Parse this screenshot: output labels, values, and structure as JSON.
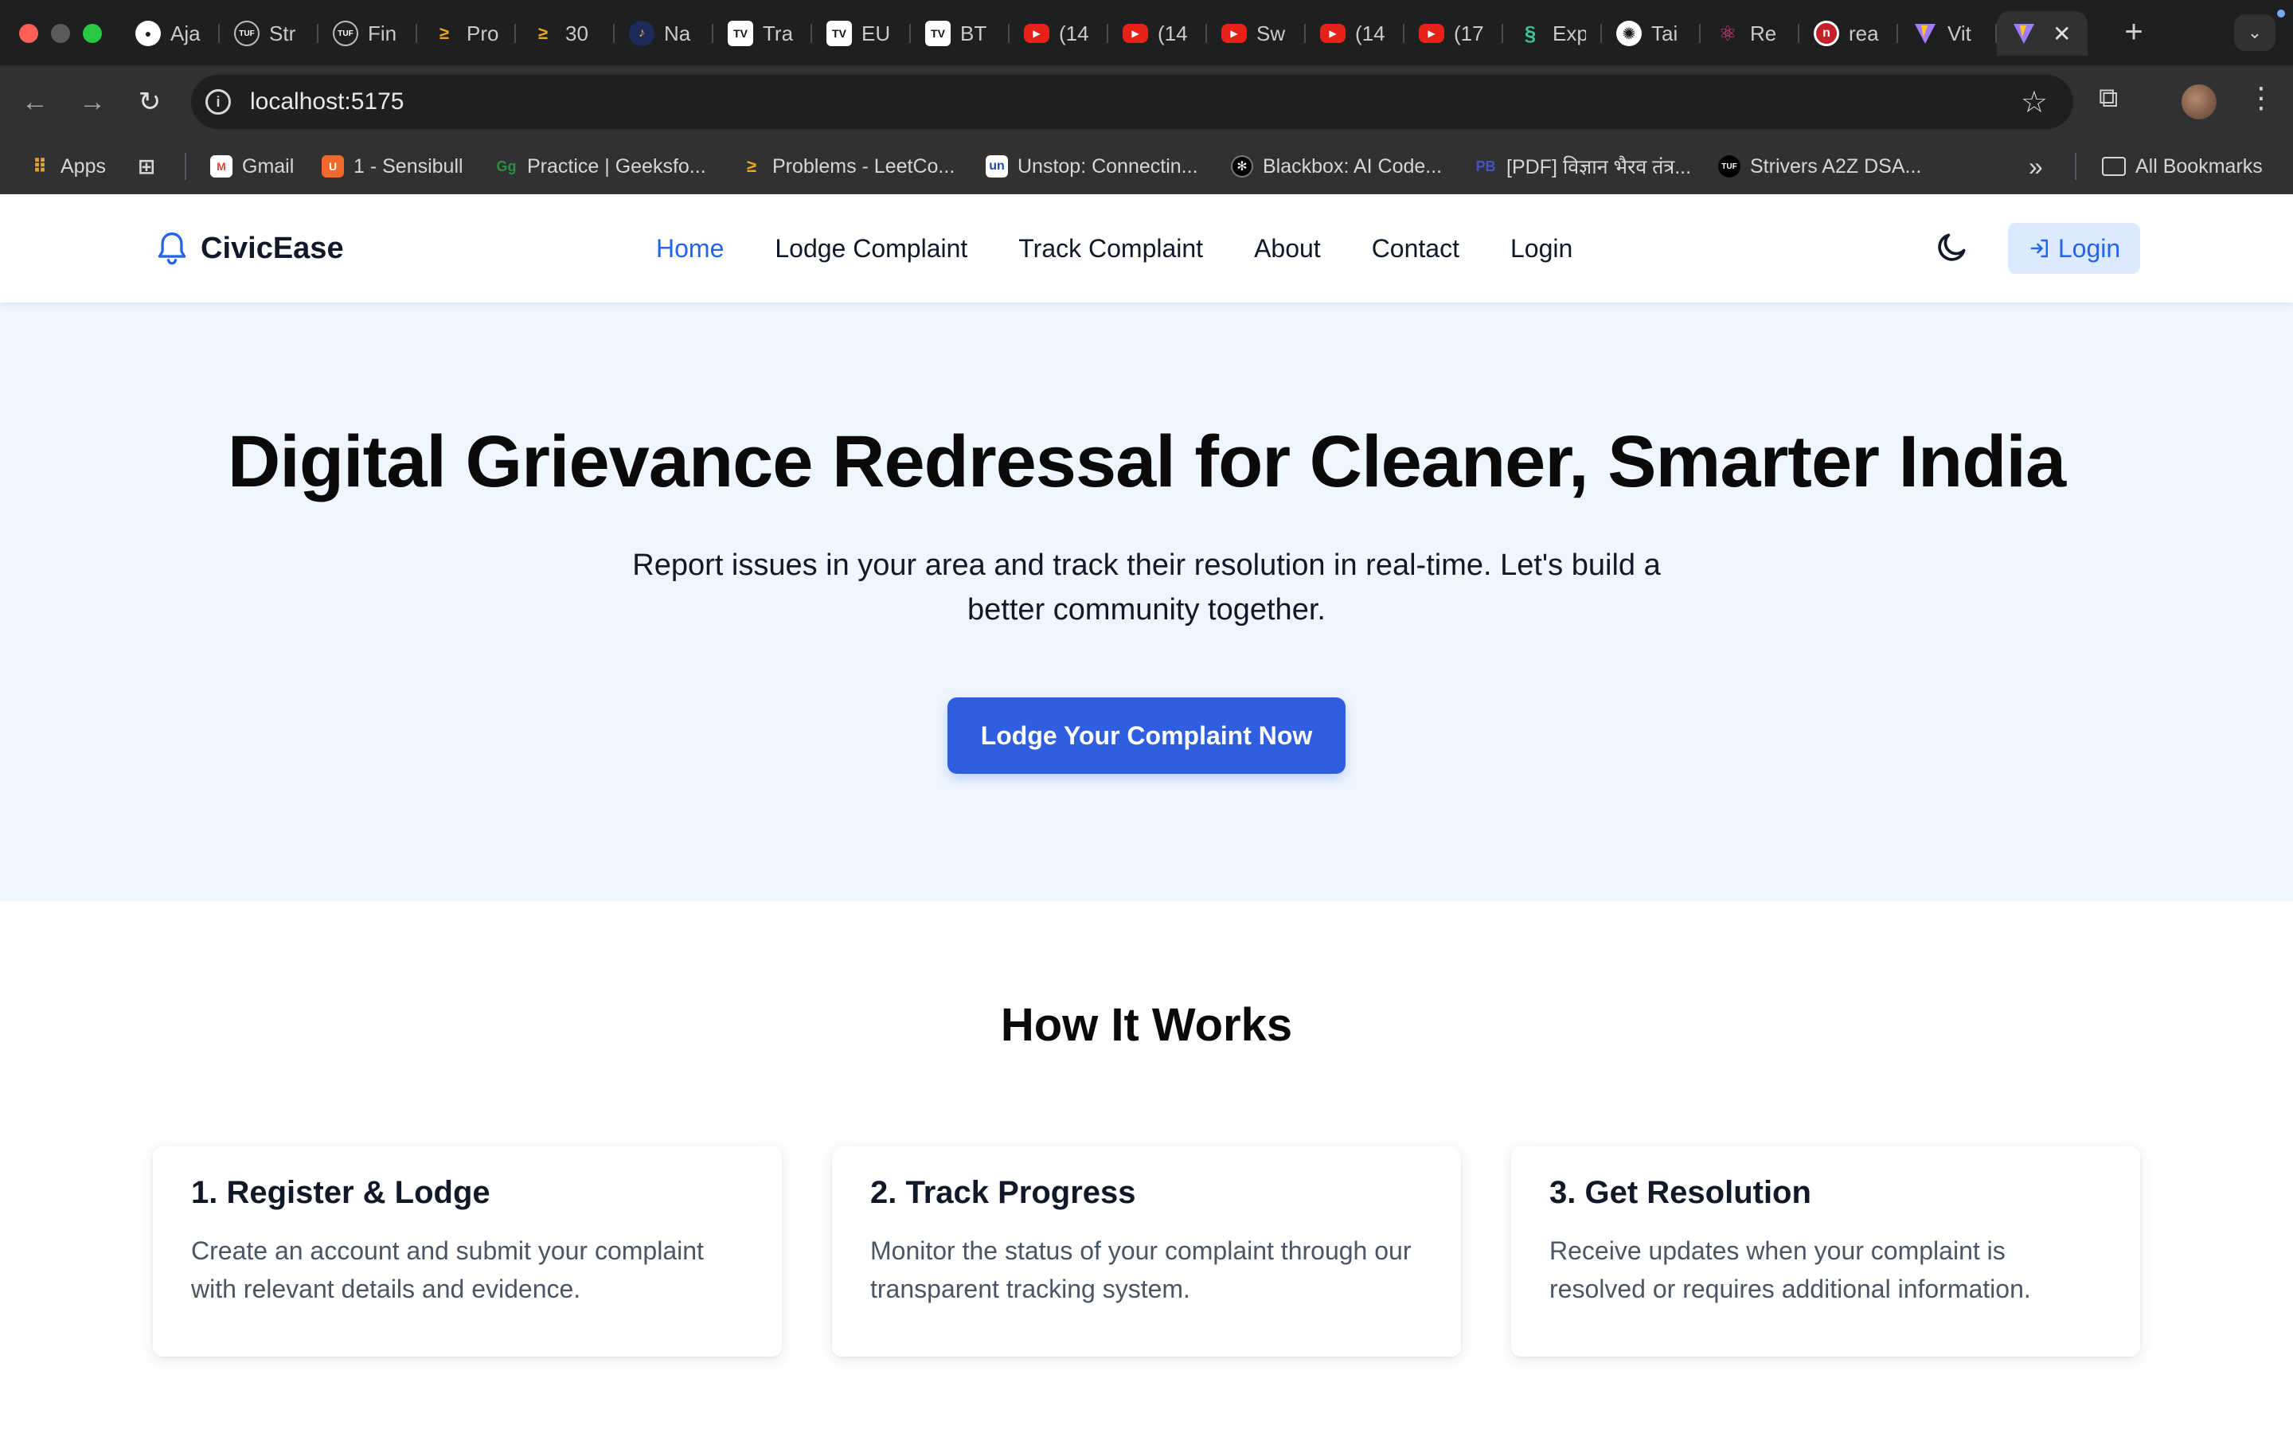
{
  "browser": {
    "tabs": [
      {
        "label": "Aja",
        "icon": "github-icon",
        "color": "#1e1f20"
      },
      {
        "label": "Str",
        "icon": "tuf-icon",
        "color": "#1e1f20"
      },
      {
        "label": "Fin",
        "icon": "tuf-icon",
        "color": "#1e1f20"
      },
      {
        "label": "Pro",
        "icon": "leetcode-icon",
        "color": "#1e1f20"
      },
      {
        "label": "30",
        "icon": "leetcode-icon",
        "color": "#1e1f20"
      },
      {
        "label": "Na",
        "icon": "app-icon",
        "color": "#1e2a5a"
      },
      {
        "label": "Tra",
        "icon": "tradingview-icon",
        "color": "#1e1f20"
      },
      {
        "label": "EU",
        "icon": "tradingview-icon",
        "color": "#1e1f20"
      },
      {
        "label": "BT",
        "icon": "tradingview-icon",
        "color": "#1e1f20"
      },
      {
        "label": "(14",
        "icon": "youtube-icon",
        "color": "#e62117"
      },
      {
        "label": "(14",
        "icon": "youtube-icon",
        "color": "#e62117"
      },
      {
        "label": "Sw",
        "icon": "youtube-icon",
        "color": "#e62117"
      },
      {
        "label": "(14",
        "icon": "youtube-icon",
        "color": "#e62117"
      },
      {
        "label": "(17",
        "icon": "youtube-icon",
        "color": "#e62117"
      },
      {
        "label": "Exp",
        "icon": "express-icon",
        "color": "#1e1f20"
      },
      {
        "label": "Tai",
        "icon": "openai-icon",
        "color": "#1e1f20"
      },
      {
        "label": "Re",
        "icon": "react-icon",
        "color": "#1e1f20"
      },
      {
        "label": "rea",
        "icon": "npm-icon",
        "color": "#c12127"
      },
      {
        "label": "Vit",
        "icon": "vite-icon",
        "color": "#1e1f20"
      }
    ],
    "active_tab_icon": "vite-icon",
    "url": "localhost:5175",
    "bookmarks": [
      {
        "label": "Apps",
        "icon": "apps-grid-icon"
      },
      {
        "label": "Gmail",
        "icon": "gmail-icon"
      },
      {
        "label": "1 - Sensibull",
        "icon": "sensibull-icon"
      },
      {
        "label": "Practice | Geeksfo...",
        "icon": "geeksforgeeks-icon"
      },
      {
        "label": "Problems - LeetCo...",
        "icon": "leetcode-icon"
      },
      {
        "label": "Unstop: Connectin...",
        "icon": "unstop-icon"
      },
      {
        "label": "Blackbox: AI Code...",
        "icon": "blackbox-icon"
      },
      {
        "label": "[PDF] विज्ञान भैरव तंत्र...",
        "icon": "pdf-icon"
      },
      {
        "label": "Strivers A2Z DSA...",
        "icon": "tuf-icon"
      }
    ],
    "all_bookmarks": "All Bookmarks",
    "overflow": "»"
  },
  "app": {
    "brand": "CivicEase",
    "nav": {
      "home": "Home",
      "lodge": "Lodge Complaint",
      "track": "Track Complaint",
      "about": "About",
      "contact": "Contact",
      "login": "Login"
    },
    "login_button": "Login",
    "accent": "#2563eb",
    "hero": {
      "title": "Digital Grievance Redressal for Cleaner, Smarter India",
      "subtitle": "Report issues in your area and track their resolution in real-time. Let's build a better community together.",
      "cta": "Lodge Your Complaint Now"
    },
    "how_title": "How It Works",
    "steps": [
      {
        "title": "1. Register & Lodge",
        "desc": "Create an account and submit your complaint with relevant details and evidence."
      },
      {
        "title": "2. Track Progress",
        "desc": "Monitor the status of your complaint through our transparent tracking system."
      },
      {
        "title": "3. Get Resolution",
        "desc": "Receive updates when your complaint is resolved or requires additional information."
      }
    ]
  }
}
